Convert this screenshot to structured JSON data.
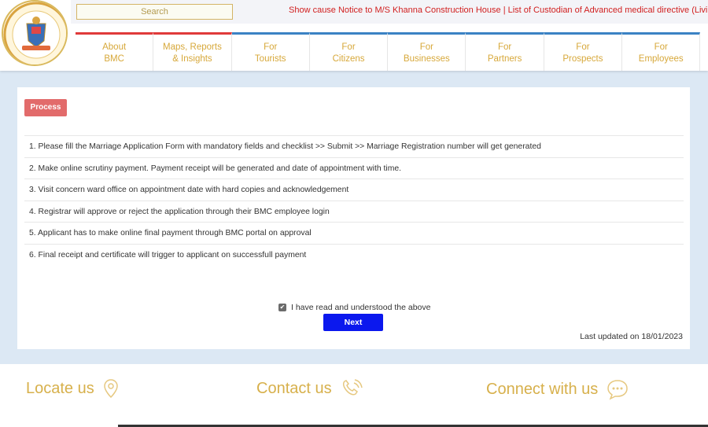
{
  "header": {
    "logo_alt": "BMC emblem",
    "search_placeholder": "Search",
    "ticker": "Show cause Notice to M/S Khanna Construction House | List of Custodian of Advanced medical directive (Living Will)"
  },
  "nav": [
    {
      "line1": "About",
      "line2": "BMC"
    },
    {
      "line1": "Maps, Reports",
      "line2": "& Insights"
    },
    {
      "line1": "For",
      "line2": "Tourists"
    },
    {
      "line1": "For",
      "line2": "Citizens"
    },
    {
      "line1": "For",
      "line2": "Businesses"
    },
    {
      "line1": "For",
      "line2": "Partners"
    },
    {
      "line1": "For",
      "line2": "Prospects"
    },
    {
      "line1": "For",
      "line2": "Employees"
    }
  ],
  "main": {
    "badge": "Process",
    "steps": [
      "1. Please fill the Marriage Application Form with mandatory fields and checklist >> Submit >> Marriage Registration number will get generated",
      "2. Make online scrutiny payment. Payment receipt will be generated and date of appointment with time.",
      "3. Visit concern ward office on appointment date with hard copies and acknowledgement",
      "4. Registrar will approve or reject the application through their BMC employee login",
      "5. Applicant has to make online final payment through BMC portal on approval",
      "6. Final receipt and certificate will trigger to applicant on successfull payment"
    ],
    "agree_label": "I have read and understood the above",
    "agree_checked": true,
    "next_label": "Next",
    "last_updated": "Last updated on 18/01/2023"
  },
  "footer": {
    "locate": "Locate us",
    "contact": "Contact us",
    "connect": "Connect with us"
  },
  "colors": {
    "accent_gold": "#d7a83a",
    "ticker_red": "#d12020",
    "next_blue": "#0b18ee",
    "badge_red": "#e26b6b"
  }
}
